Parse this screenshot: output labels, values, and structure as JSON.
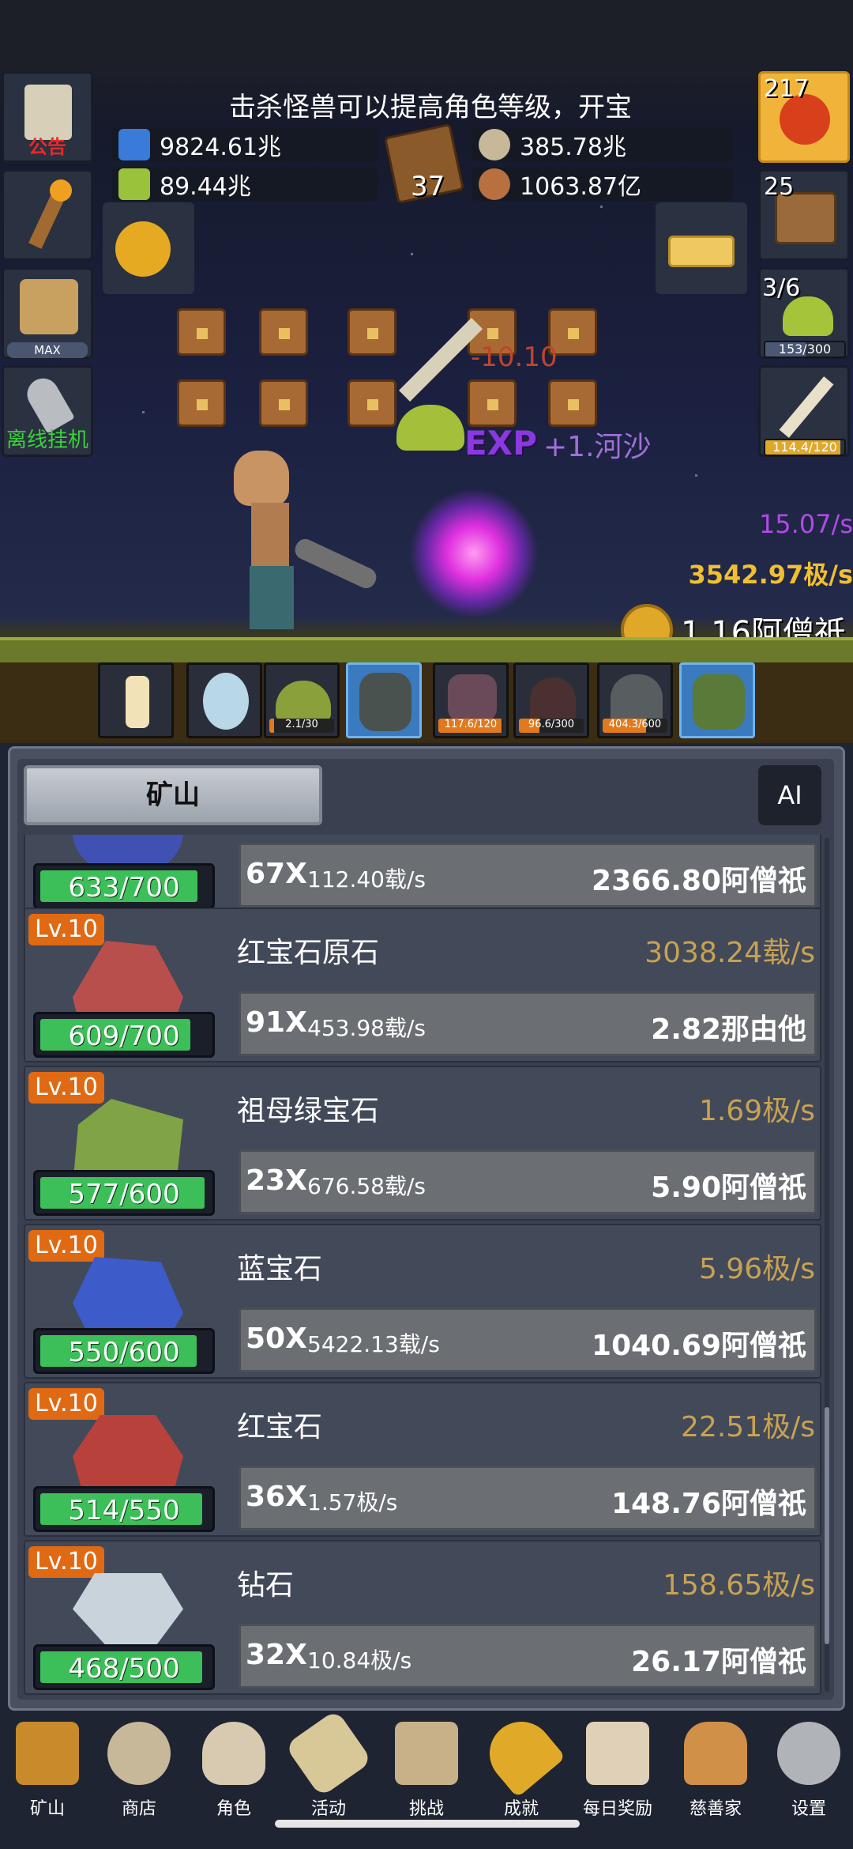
{
  "ticker_text": "击杀怪兽可以提高角色等级，开宝",
  "resources": {
    "blue_potion": "9824.61兆",
    "green_potion": "89.44兆",
    "book_count": "37",
    "shell": "385.78兆",
    "meat": "1063.87亿"
  },
  "left_buttons": {
    "announcement": "公告",
    "max_badge": "MAX",
    "offline": "离线挂机"
  },
  "right_buttons": {
    "potion_count": "217",
    "chest_count": "25",
    "slime_count": "3/6",
    "slime_bar": "153/300",
    "sword_bar": "114.4/120"
  },
  "battle": {
    "damage": "-10.10",
    "exp_text": "EXP",
    "drop_text": "+1.河沙",
    "rate_purple": "15.07/s",
    "rate_yellow": "3542.97极/s",
    "coin_total": "1.16阿僧祇"
  },
  "monsters": [
    {
      "name": "candle",
      "bar": ""
    },
    {
      "name": "egg",
      "bar": ""
    },
    {
      "name": "slime",
      "bar": "2.1/30"
    },
    {
      "name": "zombie",
      "bar": ""
    },
    {
      "name": "bat",
      "bar": "117.6/120"
    },
    {
      "name": "squid",
      "bar": "96.6/300"
    },
    {
      "name": "ghost",
      "bar": "404.3/600"
    },
    {
      "name": "orc",
      "bar": ""
    }
  ],
  "panel": {
    "tab_label": "矿山",
    "ai_label": "AI"
  },
  "gems": [
    {
      "lv": "",
      "name": "",
      "rate": "",
      "progress": "633/700",
      "mult": "67X",
      "unit_rate": "112.40载/s",
      "cost": "2366.80阿僧祇",
      "color": "#3f52b4"
    },
    {
      "lv": "Lv.10",
      "name": "红宝石原石",
      "rate": "3038.24载/s",
      "progress": "609/700",
      "mult": "91X",
      "unit_rate": "453.98载/s",
      "cost": "2.82那由他",
      "color": "#b94f4c"
    },
    {
      "lv": "Lv.10",
      "name": "祖母绿宝石",
      "rate": "1.69极/s",
      "progress": "577/600",
      "mult": "23X",
      "unit_rate": "676.58载/s",
      "cost": "5.90阿僧祇",
      "color": "#7fa345"
    },
    {
      "lv": "Lv.10",
      "name": "蓝宝石",
      "rate": "5.96极/s",
      "progress": "550/600",
      "mult": "50X",
      "unit_rate": "5422.13载/s",
      "cost": "1040.69阿僧祇",
      "color": "#3d5bc9"
    },
    {
      "lv": "Lv.10",
      "name": "红宝石",
      "rate": "22.51极/s",
      "progress": "514/550",
      "mult": "36X",
      "unit_rate": "1.57极/s",
      "cost": "148.76阿僧祇",
      "color": "#b8413c"
    },
    {
      "lv": "Lv.10",
      "name": "钻石",
      "rate": "158.65极/s",
      "progress": "468/500",
      "mult": "32X",
      "unit_rate": "10.84极/s",
      "cost": "26.17阿僧祇",
      "color": "#c9d3dc"
    }
  ],
  "nav": [
    {
      "label": "矿山",
      "icon": "lantern-icon"
    },
    {
      "label": "商店",
      "icon": "shop-icon"
    },
    {
      "label": "角色",
      "icon": "skull-icon"
    },
    {
      "label": "活动",
      "icon": "scroll-icon"
    },
    {
      "label": "挑战",
      "icon": "map-icon"
    },
    {
      "label": "成就",
      "icon": "key-icon"
    },
    {
      "label": "每日奖励",
      "icon": "letter-icon"
    },
    {
      "label": "慈善家",
      "icon": "bread-icon"
    },
    {
      "label": "设置",
      "icon": "gear-icon"
    }
  ]
}
